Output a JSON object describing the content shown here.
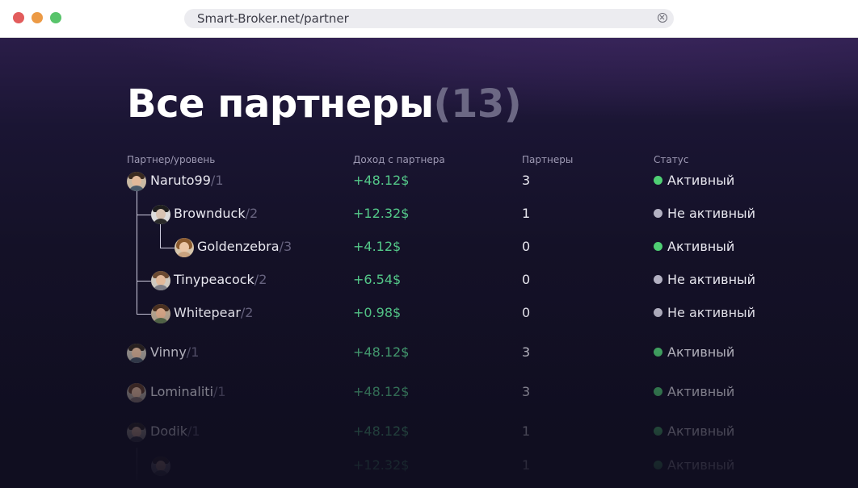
{
  "browser": {
    "url": "Smart-Broker.net/partner"
  },
  "page": {
    "title": "Все партнеры",
    "count": "(13)"
  },
  "table": {
    "headers": {
      "partner_level": "Партнер/уровень",
      "income": "Доход с партнера",
      "partners": "Партнеры",
      "status": "Статус"
    },
    "rows": [
      {
        "name": "Naruto99",
        "level": "/1",
        "income": "+48.12$",
        "partners": "3",
        "status": "Активный",
        "active": true
      },
      {
        "name": "Brownduck",
        "level": "/2",
        "income": "+12.32$",
        "partners": "1",
        "status": "Не активный",
        "active": false
      },
      {
        "name": "Goldenzebra",
        "level": "/3",
        "income": "+4.12$",
        "partners": "0",
        "status": "Активный",
        "active": true
      },
      {
        "name": "Tinypeacock",
        "level": "/2",
        "income": "+6.54$",
        "partners": "0",
        "status": "Не активный",
        "active": false
      },
      {
        "name": "Whitepear",
        "level": "/2",
        "income": "+0.98$",
        "partners": "0",
        "status": "Не активный",
        "active": false
      },
      {
        "name": "Vinny",
        "level": "/1",
        "income": "+48.12$",
        "partners": "3",
        "status": "Активный",
        "active": true
      },
      {
        "name": "Lominaliti",
        "level": "/1",
        "income": "+48.12$",
        "partners": "3",
        "status": "Активный",
        "active": true
      },
      {
        "name": "Dodik",
        "level": "/1",
        "income": "+48.12$",
        "partners": "1",
        "status": "Активный",
        "active": true
      },
      {
        "name": "",
        "level": "",
        "income": "+12.32$",
        "partners": "1",
        "status": "Активный",
        "active": true
      }
    ]
  },
  "colors": {
    "active_dot": "#4fcf74",
    "inactive_dot": "#b3b1c2",
    "income_green": "#54c889"
  }
}
